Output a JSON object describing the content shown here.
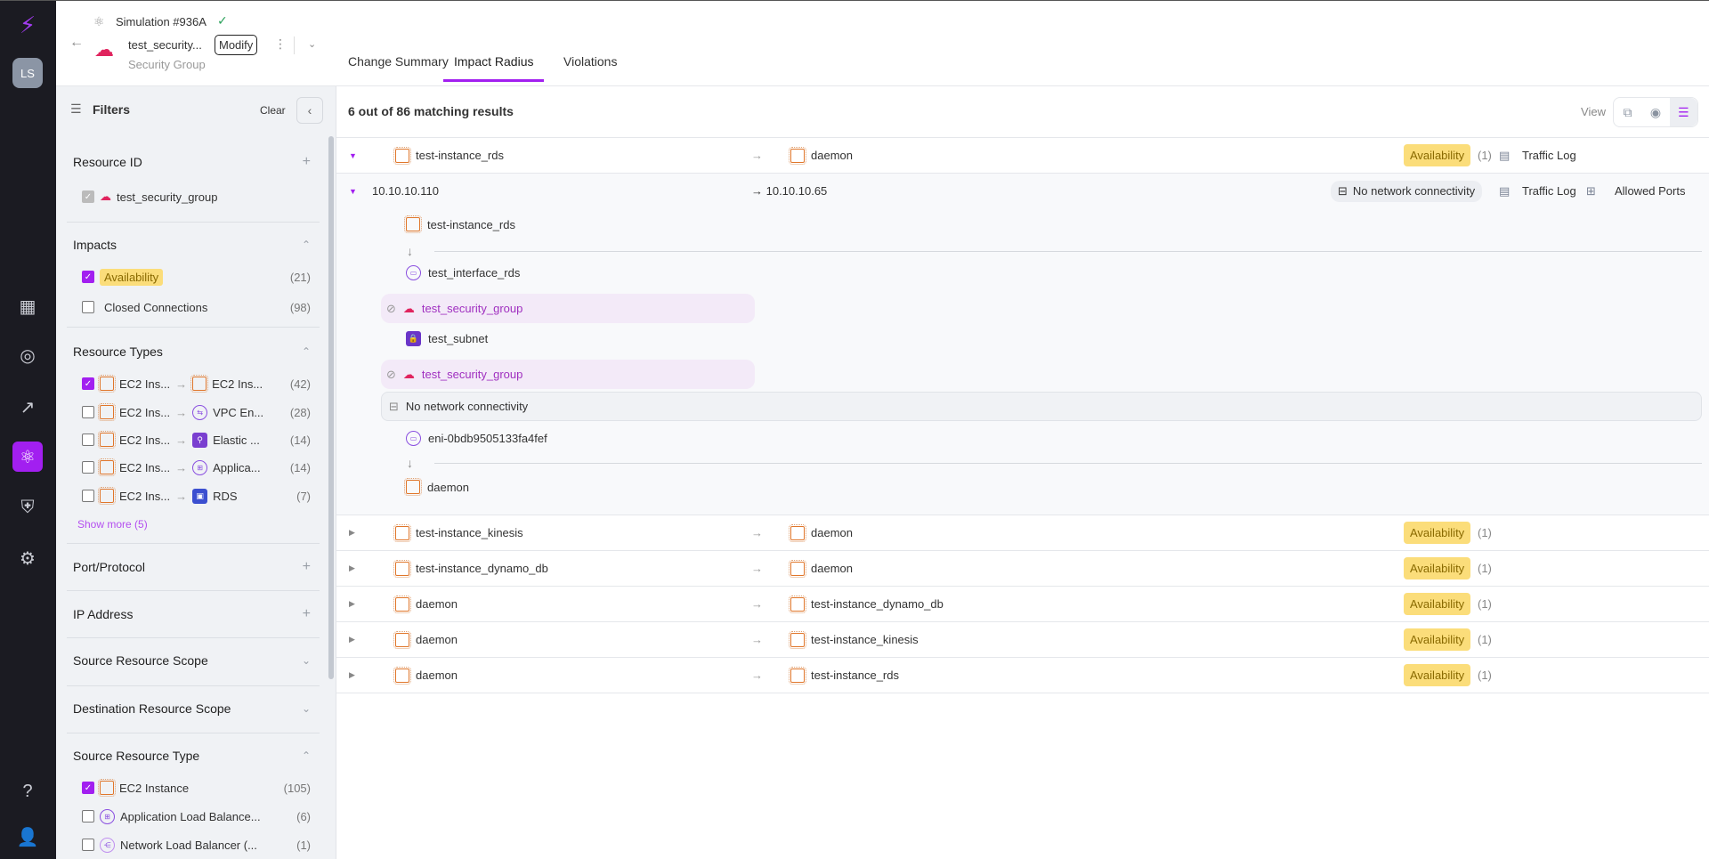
{
  "rail": {
    "avatar": "LS"
  },
  "header": {
    "simulation": "Simulation #936A",
    "resource_name": "test_security...",
    "modify": "Modify",
    "resource_type": "Security Group",
    "tabs": [
      {
        "label": "Change Summary"
      },
      {
        "label": "Impact Radius",
        "active": true
      },
      {
        "label": "Violations"
      }
    ]
  },
  "filters": {
    "title": "Filters",
    "clear": "Clear",
    "resource_id": {
      "title": "Resource ID",
      "item": "test_security_group"
    },
    "impacts": {
      "title": "Impacts",
      "items": [
        {
          "label": "Availability",
          "count": "(21)",
          "checked": true
        },
        {
          "label": "Closed Connections",
          "count": "(98)"
        }
      ]
    },
    "resource_types": {
      "title": "Resource Types",
      "items": [
        {
          "src": "EC2 Ins...",
          "dst": "EC2 Ins...",
          "count": "(42)",
          "checked": true
        },
        {
          "src": "EC2 Ins...",
          "dst": "VPC En...",
          "count": "(28)"
        },
        {
          "src": "EC2 Ins...",
          "dst": "Elastic ...",
          "count": "(14)"
        },
        {
          "src": "EC2 Ins...",
          "dst": "Applica...",
          "count": "(14)"
        },
        {
          "src": "EC2 Ins...",
          "dst": "RDS",
          "count": "(7)"
        }
      ],
      "show_more": "Show more (5)"
    },
    "port_protocol": "Port/Protocol",
    "ip_address": "IP Address",
    "source_scope": "Source Resource Scope",
    "dest_scope": "Destination Resource Scope",
    "source_type": {
      "title": "Source Resource Type",
      "items": [
        {
          "label": "EC2 Instance",
          "count": "(105)",
          "checked": true
        },
        {
          "label": "Application Load Balance...",
          "count": "(6)"
        },
        {
          "label": "Network Load Balancer (...",
          "count": "(1)"
        }
      ]
    }
  },
  "results": {
    "summary": "6 out of 86 matching results",
    "view_label": "View",
    "rows": [
      {
        "src": "test-instance_rds",
        "dst": "daemon",
        "badge": "Availability",
        "count": "(1)",
        "traffic": "Traffic Log"
      },
      {
        "src": "test-instance_kinesis",
        "dst": "daemon",
        "badge": "Availability",
        "count": "(1)"
      },
      {
        "src": "test-instance_dynamo_db",
        "dst": "daemon",
        "badge": "Availability",
        "count": "(1)"
      },
      {
        "src": "daemon",
        "dst": "test-instance_dynamo_db",
        "badge": "Availability",
        "count": "(1)"
      },
      {
        "src": "daemon",
        "dst": "test-instance_kinesis",
        "badge": "Availability",
        "count": "(1)"
      },
      {
        "src": "daemon",
        "dst": "test-instance_rds",
        "badge": "Availability",
        "count": "(1)"
      }
    ],
    "sub": {
      "src_ip": "10.10.10.110",
      "dst_ip": "→ 10.10.10.65",
      "status": "No network connectivity",
      "traffic": "Traffic Log",
      "ports": "Allowed Ports"
    },
    "path": {
      "s1": "test-instance_rds",
      "s2": "test_interface_rds",
      "s3": "test_security_group",
      "s4": "test_subnet",
      "s5": "test_security_group",
      "s6": "No network connectivity",
      "s7": "eni-0bdb9505133fa4fef",
      "s8": "daemon"
    }
  }
}
